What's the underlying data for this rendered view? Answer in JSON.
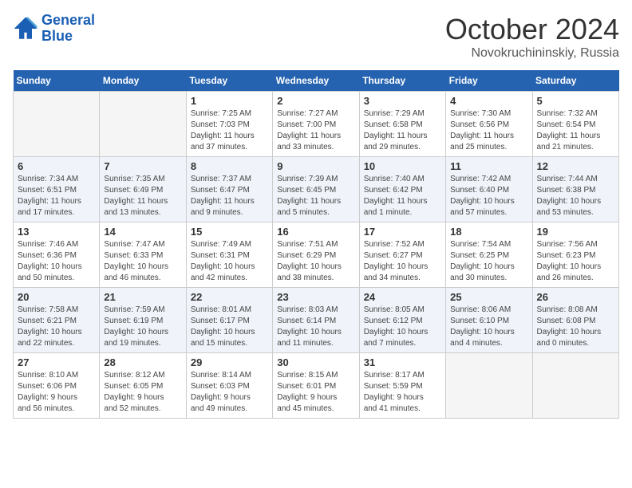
{
  "header": {
    "logo_line1": "General",
    "logo_line2": "Blue",
    "month": "October 2024",
    "location": "Novokruchininskiy, Russia"
  },
  "weekdays": [
    "Sunday",
    "Monday",
    "Tuesday",
    "Wednesday",
    "Thursday",
    "Friday",
    "Saturday"
  ],
  "weeks": [
    [
      {
        "day": "",
        "detail": ""
      },
      {
        "day": "",
        "detail": ""
      },
      {
        "day": "1",
        "detail": "Sunrise: 7:25 AM\nSunset: 7:03 PM\nDaylight: 11 hours\nand 37 minutes."
      },
      {
        "day": "2",
        "detail": "Sunrise: 7:27 AM\nSunset: 7:00 PM\nDaylight: 11 hours\nand 33 minutes."
      },
      {
        "day": "3",
        "detail": "Sunrise: 7:29 AM\nSunset: 6:58 PM\nDaylight: 11 hours\nand 29 minutes."
      },
      {
        "day": "4",
        "detail": "Sunrise: 7:30 AM\nSunset: 6:56 PM\nDaylight: 11 hours\nand 25 minutes."
      },
      {
        "day": "5",
        "detail": "Sunrise: 7:32 AM\nSunset: 6:54 PM\nDaylight: 11 hours\nand 21 minutes."
      }
    ],
    [
      {
        "day": "6",
        "detail": "Sunrise: 7:34 AM\nSunset: 6:51 PM\nDaylight: 11 hours\nand 17 minutes."
      },
      {
        "day": "7",
        "detail": "Sunrise: 7:35 AM\nSunset: 6:49 PM\nDaylight: 11 hours\nand 13 minutes."
      },
      {
        "day": "8",
        "detail": "Sunrise: 7:37 AM\nSunset: 6:47 PM\nDaylight: 11 hours\nand 9 minutes."
      },
      {
        "day": "9",
        "detail": "Sunrise: 7:39 AM\nSunset: 6:45 PM\nDaylight: 11 hours\nand 5 minutes."
      },
      {
        "day": "10",
        "detail": "Sunrise: 7:40 AM\nSunset: 6:42 PM\nDaylight: 11 hours\nand 1 minute."
      },
      {
        "day": "11",
        "detail": "Sunrise: 7:42 AM\nSunset: 6:40 PM\nDaylight: 10 hours\nand 57 minutes."
      },
      {
        "day": "12",
        "detail": "Sunrise: 7:44 AM\nSunset: 6:38 PM\nDaylight: 10 hours\nand 53 minutes."
      }
    ],
    [
      {
        "day": "13",
        "detail": "Sunrise: 7:46 AM\nSunset: 6:36 PM\nDaylight: 10 hours\nand 50 minutes."
      },
      {
        "day": "14",
        "detail": "Sunrise: 7:47 AM\nSunset: 6:33 PM\nDaylight: 10 hours\nand 46 minutes."
      },
      {
        "day": "15",
        "detail": "Sunrise: 7:49 AM\nSunset: 6:31 PM\nDaylight: 10 hours\nand 42 minutes."
      },
      {
        "day": "16",
        "detail": "Sunrise: 7:51 AM\nSunset: 6:29 PM\nDaylight: 10 hours\nand 38 minutes."
      },
      {
        "day": "17",
        "detail": "Sunrise: 7:52 AM\nSunset: 6:27 PM\nDaylight: 10 hours\nand 34 minutes."
      },
      {
        "day": "18",
        "detail": "Sunrise: 7:54 AM\nSunset: 6:25 PM\nDaylight: 10 hours\nand 30 minutes."
      },
      {
        "day": "19",
        "detail": "Sunrise: 7:56 AM\nSunset: 6:23 PM\nDaylight: 10 hours\nand 26 minutes."
      }
    ],
    [
      {
        "day": "20",
        "detail": "Sunrise: 7:58 AM\nSunset: 6:21 PM\nDaylight: 10 hours\nand 22 minutes."
      },
      {
        "day": "21",
        "detail": "Sunrise: 7:59 AM\nSunset: 6:19 PM\nDaylight: 10 hours\nand 19 minutes."
      },
      {
        "day": "22",
        "detail": "Sunrise: 8:01 AM\nSunset: 6:17 PM\nDaylight: 10 hours\nand 15 minutes."
      },
      {
        "day": "23",
        "detail": "Sunrise: 8:03 AM\nSunset: 6:14 PM\nDaylight: 10 hours\nand 11 minutes."
      },
      {
        "day": "24",
        "detail": "Sunrise: 8:05 AM\nSunset: 6:12 PM\nDaylight: 10 hours\nand 7 minutes."
      },
      {
        "day": "25",
        "detail": "Sunrise: 8:06 AM\nSunset: 6:10 PM\nDaylight: 10 hours\nand 4 minutes."
      },
      {
        "day": "26",
        "detail": "Sunrise: 8:08 AM\nSunset: 6:08 PM\nDaylight: 10 hours\nand 0 minutes."
      }
    ],
    [
      {
        "day": "27",
        "detail": "Sunrise: 8:10 AM\nSunset: 6:06 PM\nDaylight: 9 hours\nand 56 minutes."
      },
      {
        "day": "28",
        "detail": "Sunrise: 8:12 AM\nSunset: 6:05 PM\nDaylight: 9 hours\nand 52 minutes."
      },
      {
        "day": "29",
        "detail": "Sunrise: 8:14 AM\nSunset: 6:03 PM\nDaylight: 9 hours\nand 49 minutes."
      },
      {
        "day": "30",
        "detail": "Sunrise: 8:15 AM\nSunset: 6:01 PM\nDaylight: 9 hours\nand 45 minutes."
      },
      {
        "day": "31",
        "detail": "Sunrise: 8:17 AM\nSunset: 5:59 PM\nDaylight: 9 hours\nand 41 minutes."
      },
      {
        "day": "",
        "detail": ""
      },
      {
        "day": "",
        "detail": ""
      }
    ]
  ]
}
